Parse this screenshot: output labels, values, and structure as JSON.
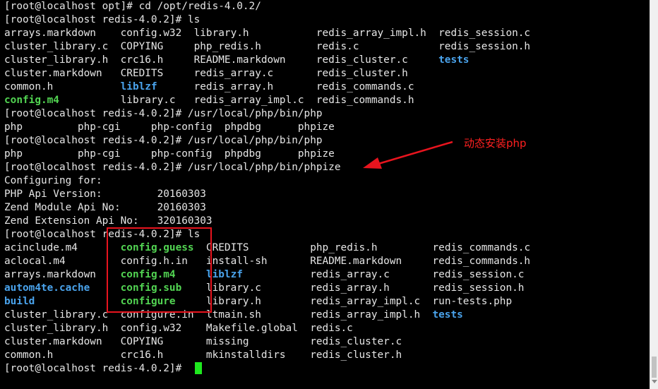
{
  "terminal": {
    "lines": [
      [
        {
          "t": "[root@localhost opt]# cd /opt/redis-4.0.2/"
        }
      ],
      [
        {
          "t": "[root@localhost redis-4.0.2]# ls"
        }
      ],
      [
        {
          "t": "arrays.markdown    config.w32  library.h           redis_array_impl.h  redis_session.c"
        }
      ],
      [
        {
          "t": "cluster_library.c  COPYING     php_redis.h         redis.c             redis_session.h"
        }
      ],
      [
        {
          "t": "cluster_library.h  crc16.h     README.markdown     redis_cluster.c     "
        },
        {
          "t": "tests",
          "c": "c-blue"
        }
      ],
      [
        {
          "t": "cluster.markdown   CREDITS     redis_array.c       redis_cluster.h"
        }
      ],
      [
        {
          "t": "common.h           "
        },
        {
          "t": "liblzf",
          "c": "c-blue"
        },
        {
          "t": "      redis_array.h       redis_commands.c"
        }
      ],
      [
        {
          "t": "config.m4",
          "c": "c-green"
        },
        {
          "t": "          library.c   redis_array_impl.c  redis_commands.h"
        }
      ],
      [
        {
          "t": "[root@localhost redis-4.0.2]# /usr/local/php/bin/php"
        }
      ],
      [
        {
          "t": "php         php-cgi     php-config  phpdbg      phpize"
        }
      ],
      [
        {
          "t": "[root@localhost redis-4.0.2]# /usr/local/php/bin/php"
        }
      ],
      [
        {
          "t": "php         php-cgi     php-config  phpdbg      phpize"
        }
      ],
      [
        {
          "t": "[root@localhost redis-4.0.2]# /usr/local/php/bin/phpize"
        }
      ],
      [
        {
          "t": "Configuring for:"
        }
      ],
      [
        {
          "t": "PHP Api Version:         20160303"
        }
      ],
      [
        {
          "t": "Zend Module Api No:      20160303"
        }
      ],
      [
        {
          "t": "Zend Extension Api No:   320160303"
        }
      ],
      [
        {
          "t": "[root@localhost redis-4.0.2]# ls"
        }
      ],
      [
        {
          "t": "acinclude.m4       "
        },
        {
          "t": "config.guess",
          "c": "c-green"
        },
        {
          "t": "  CREDITS          php_redis.h         redis_commands.c"
        }
      ],
      [
        {
          "t": "aclocal.m4         config.h.in   install-sh       README.markdown     redis_commands.h"
        }
      ],
      [
        {
          "t": "arrays.markdown    "
        },
        {
          "t": "config.m4",
          "c": "c-green"
        },
        {
          "t": "     "
        },
        {
          "t": "liblzf",
          "c": "c-blue"
        },
        {
          "t": "           redis_array.c       redis_session.c"
        }
      ],
      [
        {
          "t": "autom4te.cache",
          "c": "c-blue"
        },
        {
          "t": "     "
        },
        {
          "t": "config.sub",
          "c": "c-green"
        },
        {
          "t": "    library.c        redis_array.h       redis_session.h"
        }
      ],
      [
        {
          "t": "build",
          "c": "c-blue"
        },
        {
          "t": "              "
        },
        {
          "t": "configure",
          "c": "c-green"
        },
        {
          "t": "     library.h        redis_array_impl.c  run-tests.php"
        }
      ],
      [
        {
          "t": "cluster_library.c  configure.in  ltmain.sh        redis_array_impl.h  "
        },
        {
          "t": "tests",
          "c": "c-blue"
        }
      ],
      [
        {
          "t": "cluster_library.h  config.w32    Makefile.global  redis.c"
        }
      ],
      [
        {
          "t": "cluster.markdown   COPYING       missing          redis_cluster.c"
        }
      ],
      [
        {
          "t": "common.h           crc16.h       mkinstalldirs    redis_cluster.h"
        }
      ],
      [
        {
          "t": "[root@localhost redis-4.0.2]# "
        }
      ]
    ]
  },
  "annotation": {
    "label": "动态安装php",
    "color": "#e8141e"
  },
  "colors": {
    "background": "#000000",
    "text": "#e6e6e6",
    "executable": "#52d452",
    "directory": "#4aa3ec",
    "cursor": "#1ee81e"
  }
}
